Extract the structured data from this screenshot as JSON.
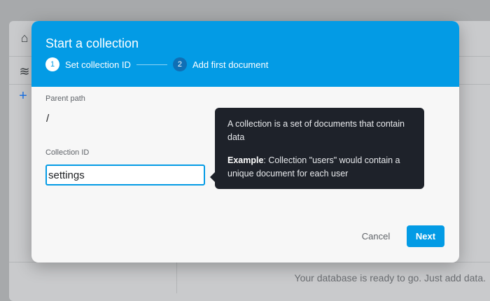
{
  "background": {
    "footer_text": "Your database is ready to go. Just add data."
  },
  "dialog": {
    "title": "Start a collection",
    "steps": [
      {
        "number": "1",
        "label": "Set collection ID"
      },
      {
        "number": "2",
        "label": "Add first document"
      }
    ],
    "parent_path_label": "Parent path",
    "parent_path_value": "/",
    "collection_id_label": "Collection ID",
    "collection_id_value": "settings",
    "tooltip": {
      "line1": "A collection is a set of documents that contain data",
      "example_label": "Example",
      "example_text": ": Collection \"users\" would contain a unique document for each user"
    },
    "cancel_label": "Cancel",
    "next_label": "Next"
  },
  "colors": {
    "header": "#039be5",
    "tooltip_bg": "#1e222a",
    "primary_button": "#039be5"
  }
}
